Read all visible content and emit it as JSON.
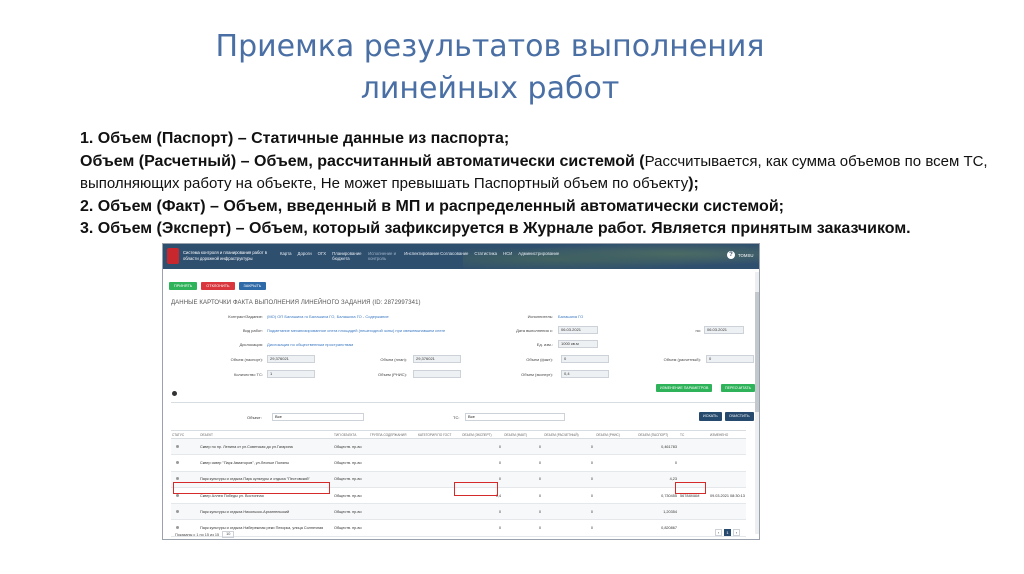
{
  "slide": {
    "title_line1": "Приемка результатов выполнения",
    "title_line2": "линейных работ",
    "desc": {
      "l1": "1. Объем (Паспорт) – Статичные данные из паспорта;",
      "l2a": "Объем (Расчетный) – Объем, рассчитанный автоматически системой (",
      "l2b": "Рассчитывается, как сумма объемов по всем ТС,",
      "l3a": "выполняющих работу на объекте, Не может превышать Паспортный объем по объекту",
      "l3b": ");",
      "l4": "2. Объем (Факт) – Объем, введенный в МП и распределенный автоматически системой;",
      "l5": "3. Объем (Эксперт) – Объем, который зафиксируется в Журнале работ. Является принятым заказчиком."
    }
  },
  "app": {
    "system_name": "Система контроля и планирования работ в области дорожной инфраструктуры",
    "nav": [
      "Карта",
      "Дороги",
      "ОГХ",
      "Планирование бюджета",
      "Исполнение и контроль",
      "Инспектирование",
      "Согласование",
      "Статистика",
      "НСИ",
      "Администрирование"
    ],
    "help_icon": "?",
    "user": "TOMSU",
    "buttons": {
      "accept": "ПРИНЯТЬ",
      "reject": "ОТКЛОНИТЬ",
      "close": "ЗАКРЫТЬ"
    },
    "card_title": "ДАННЫЕ КАРТОЧКИ ФАКТА ВЫПОЛНЕНИЯ ЛИНЕЙНОГО ЗАДАНИЯ (ID: 2872997341)",
    "fields": {
      "contract_label": "Контракт/Задание:",
      "contract_value": "(МО) ОП Балашиха го Балашиха ГО, Балашиха ГО - Содержание",
      "work_label": "Вид работ:",
      "work_value": "Подметание механизированное снега площадей (пешеходной зоны) при свежевыпавшем снеге",
      "disl_label": "Дислокация:",
      "disl_value": "Дислокация по общественным пространствам",
      "executor_label": "Исполнитель:",
      "executor_value": "Балашиха ГО",
      "date_label": "Дата выполнения с:",
      "date_value": "06.03.2021",
      "to_label": "по:",
      "to_value": "06.03.2021",
      "unit_label": "Ед. изм.:",
      "unit_value": "1000 кв.м",
      "vpass_label": "Объем (паспорт):",
      "vpass_value": "29,376021",
      "vplan_label": "Объем (план):",
      "vplan_value": "29,376021",
      "vfact_label": "Объем (факт):",
      "vfact_value": "0",
      "vcalc_label": "Объем (расчетный):",
      "vcalc_value": "0",
      "qty_label": "Количество ТС:",
      "qty_value": "1",
      "vrnis_label": "Объем (РНИС):",
      "vrnis_value": "",
      "vexp_label": "Объем (эксперт):",
      "vexp_value": "0,4",
      "btn_change": "ИЗМЕНЕНИЕ ПАРАМЕТРОВ",
      "btn_recalc": "ПЕРЕСЧИТАТЬ"
    },
    "filter": {
      "object_label": "Объект:",
      "object_value": "Все",
      "tc_label": "ТС:",
      "tc_value": "Все",
      "btn_search": "ИСКАТЬ",
      "btn_clear": "ОЧИСТИТЬ"
    },
    "table": {
      "headers": [
        "СТАТУС",
        "ОБЪЕКТ",
        "ТИП ОБЪЕКТА",
        "ГРУППА СОДЕРЖАНИЯ",
        "КАТЕГОРИЯ ПО ГОСТ",
        "ОБЪЕМ (ЭКСПЕРТ)",
        "ОБЪЕМ (ФАКТ)",
        "ОБЪЕМ (РАСЧЕТНЫЙ)",
        "ОБЪЕМ (РНИС)",
        "ОБЪЕМ (ПАСПОРТ)",
        "ТС",
        "ИЗМЕНЕНО"
      ],
      "rows": [
        {
          "object": "Сквер по пр. Ленина от ул.Советская до ул.Гагарина",
          "type": "Обществ. пр-во",
          "expert": "0",
          "fact": "0",
          "calc": "0",
          "pass": "0,461783",
          "tc": "",
          "changed": ""
        },
        {
          "object": "Сквер сквер \"Парк Авиаторов\", ул.Лесные Поляны",
          "type": "Обществ. пр-во",
          "expert": "0",
          "fact": "0",
          "calc": "0",
          "pass": "0",
          "tc": "",
          "changed": ""
        },
        {
          "object": "Парк культуры и отдыха Парк культуры и отдыха \"Пестовский\"",
          "type": "Обществ. пр-во",
          "expert": "0",
          "fact": "0",
          "calc": "0",
          "pass": "4,23",
          "tc": "",
          "changed": ""
        },
        {
          "object": "Сквер Аллея Победы ул. Востонная",
          "type": "Обществ. пр-во",
          "expert": "0,4",
          "fact": "0",
          "calc": "0",
          "pass": "0,730455",
          "tc": "56784МАМ",
          "changed": "09.03.2021 08:30:13"
        },
        {
          "object": "Парк культуры и отдыха Никольско-Архангельский",
          "type": "Обществ. пр-во",
          "expert": "0",
          "fact": "0",
          "calc": "0",
          "pass": "1,20354",
          "tc": "",
          "changed": ""
        },
        {
          "object": "Парк культуры и отдыха Набережная реки Пехорка, улица Солнечная",
          "type": "Обществ. пр-во",
          "expert": "0",
          "fact": "0",
          "calc": "0",
          "pass": "0,820867",
          "tc": "",
          "changed": ""
        }
      ]
    },
    "pager": {
      "text": "Показаны с 1 по 15 из 15",
      "size": "10",
      "prev": "‹",
      "page": "1",
      "next": "›"
    }
  }
}
